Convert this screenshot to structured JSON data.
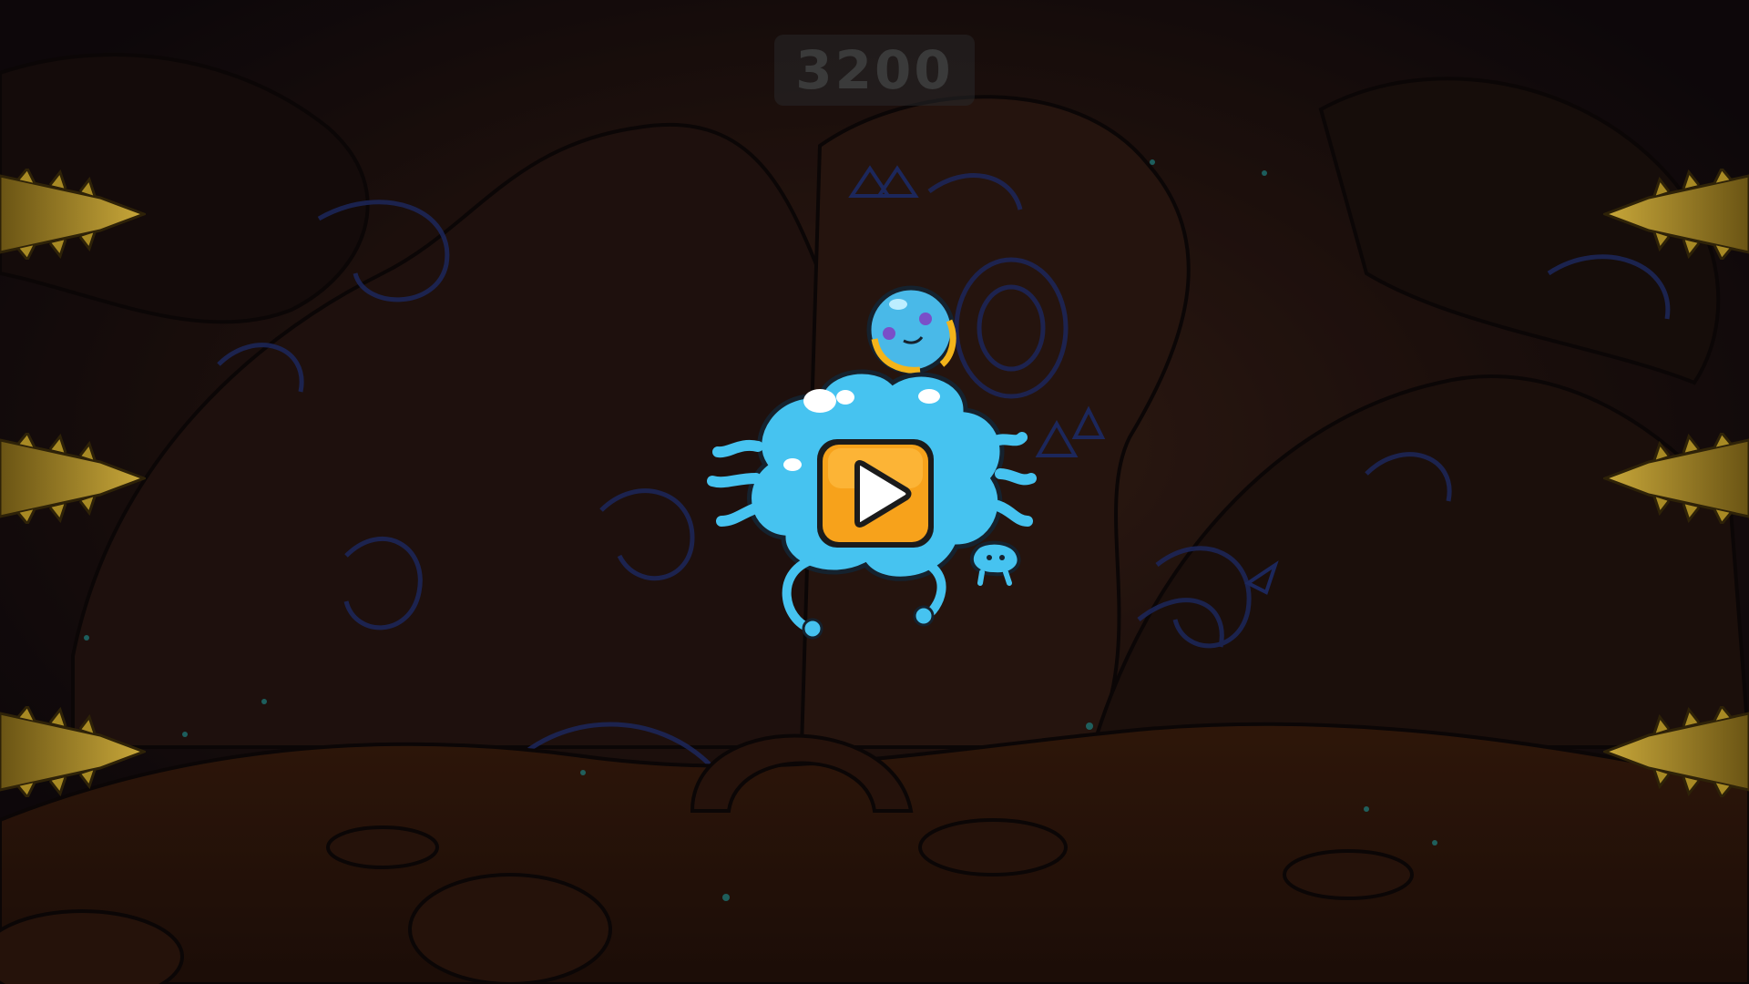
{
  "game": {
    "score": "3200"
  },
  "controls": {
    "play_icon": "play-triangle-icon"
  },
  "colors": {
    "background_dark": "#1a1012",
    "rock_brown": "#3b1f16",
    "ground_brown": "#4a2616",
    "swirl_blue": "#2a3a8a",
    "slime_blue": "#4cc6f2",
    "play_button_orange": "#f7a21b",
    "play_button_border": "#1b1b1b",
    "spike_gold": "#b89a2a",
    "score_text": "#3a3a3a"
  }
}
